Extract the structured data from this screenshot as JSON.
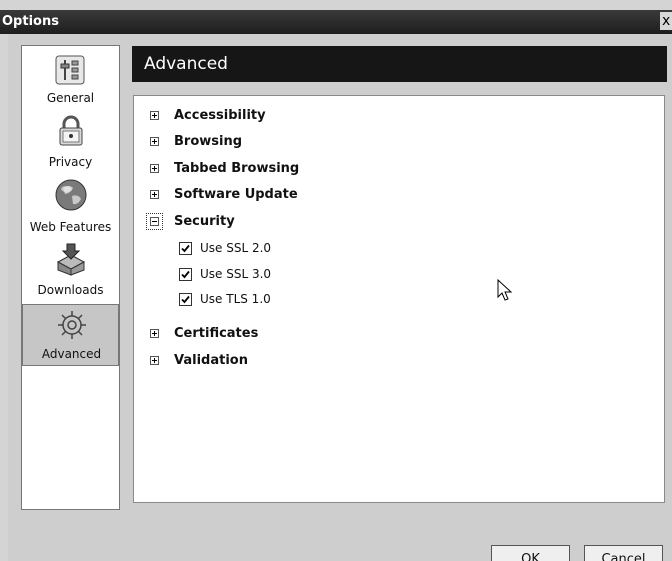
{
  "window": {
    "title": "Options",
    "close_glyph": "x"
  },
  "sidebar": {
    "items": [
      {
        "label": "General",
        "icon": "general-settings-icon",
        "selected": false
      },
      {
        "label": "Privacy",
        "icon": "lock-icon",
        "selected": false
      },
      {
        "label": "Web Features",
        "icon": "globe-icon",
        "selected": false
      },
      {
        "label": "Downloads",
        "icon": "download-box-icon",
        "selected": false
      },
      {
        "label": "Advanced",
        "icon": "gears-icon",
        "selected": true
      }
    ]
  },
  "panel": {
    "title": "Advanced",
    "tree": [
      {
        "label": "Accessibility",
        "expanded": false
      },
      {
        "label": "Browsing",
        "expanded": false
      },
      {
        "label": "Tabbed Browsing",
        "expanded": false
      },
      {
        "label": "Software Update",
        "expanded": false
      },
      {
        "label": "Security",
        "expanded": true,
        "children": [
          {
            "label": "Use SSL 2.0",
            "checked": true
          },
          {
            "label": "Use SSL 3.0",
            "checked": true
          },
          {
            "label": "Use TLS 1.0",
            "checked": true
          }
        ]
      },
      {
        "label": "Certificates",
        "expanded": false
      },
      {
        "label": "Validation",
        "expanded": false
      }
    ]
  },
  "buttons": {
    "ok": "OK",
    "cancel": "Cancel"
  }
}
